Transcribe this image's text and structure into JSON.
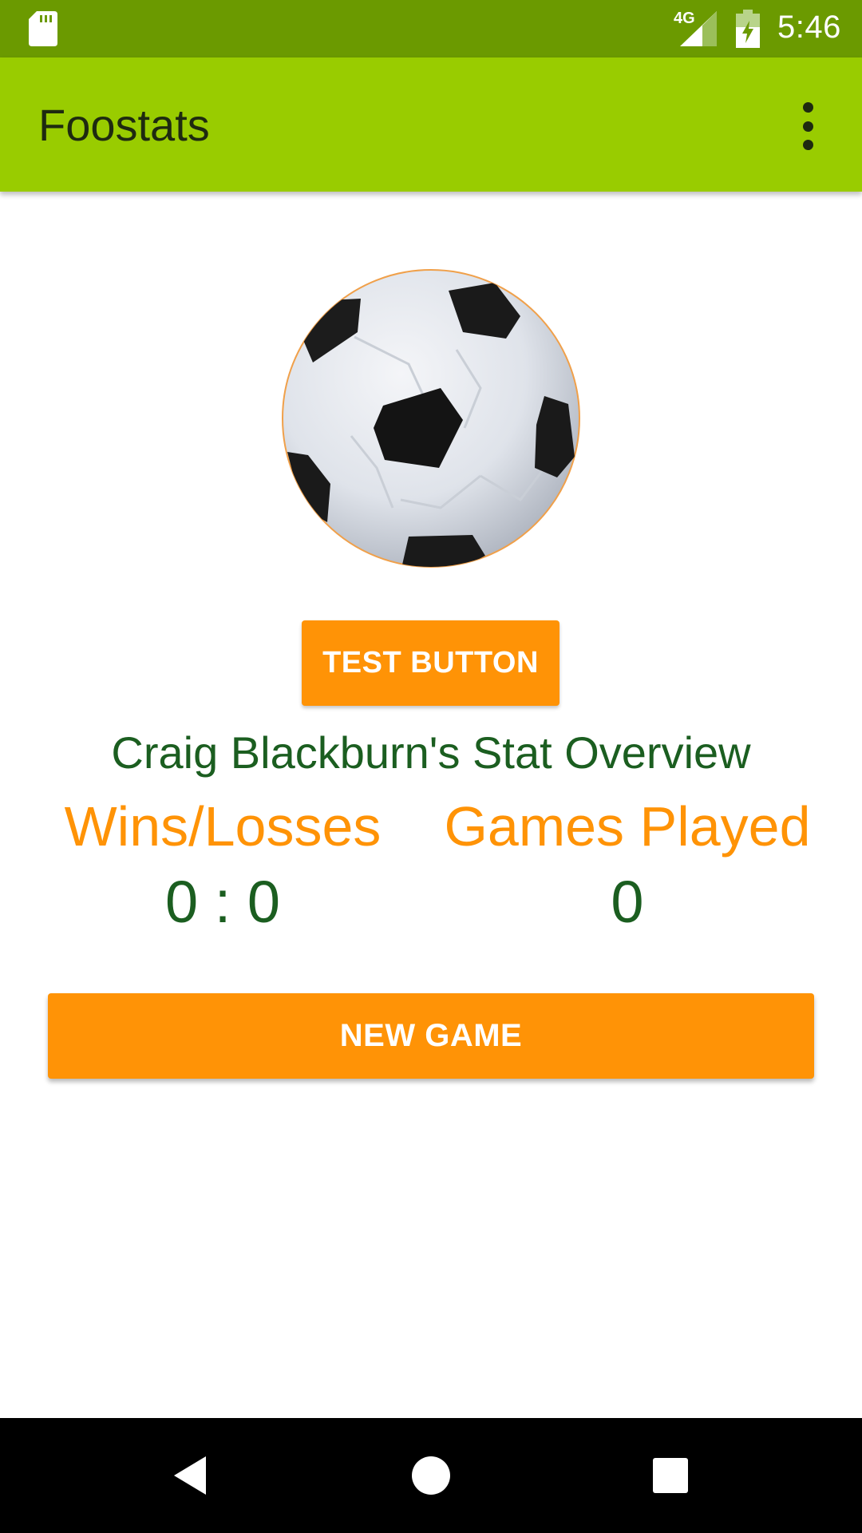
{
  "status_bar": {
    "network": "4G",
    "time": "5:46",
    "icons": [
      "sd-card-icon",
      "signal-icon",
      "battery-charging-icon"
    ]
  },
  "app_bar": {
    "title": "Foostats",
    "overflow_icon": "more-vert-icon"
  },
  "main": {
    "image": "soccer-ball",
    "test_button_label": "TEST BUTTON",
    "overview_title": "Craig Blackburn's Stat Overview",
    "stats": {
      "wins_losses_label": "Wins/Losses",
      "wins_losses_value": "0 : 0",
      "games_played_label": "Games Played",
      "games_played_value": "0"
    },
    "new_game_label": "NEW GAME"
  },
  "nav_bar": {
    "buttons": [
      "back-icon",
      "home-icon",
      "recents-icon"
    ]
  },
  "colors": {
    "status_bar": "#6b9a00",
    "app_bar": "#99cc00",
    "accent": "#ff9306",
    "text_green": "#1b5e20"
  }
}
